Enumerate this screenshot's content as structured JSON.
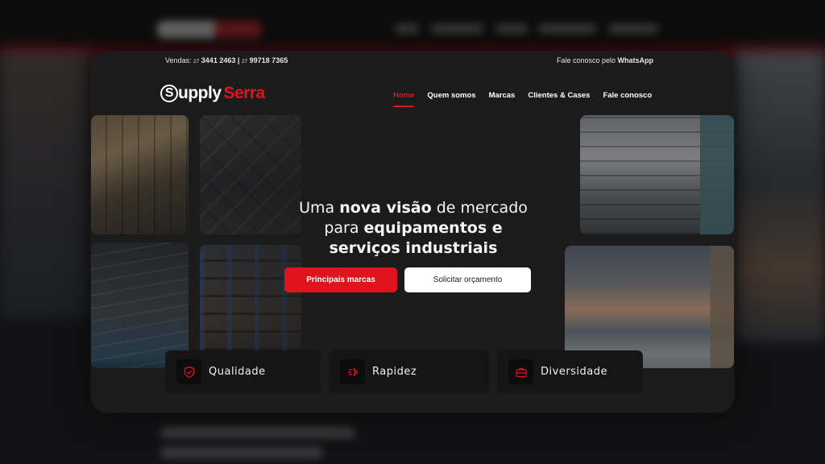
{
  "topbar": {
    "sales_label": "Vendas:",
    "phone1_prefix": "27",
    "phone1": "3441 2463",
    "separator": "|",
    "phone2_prefix": "27",
    "phone2": "99718 7365",
    "contact_text": "Fale conosco pelo",
    "contact_channel": "WhatsApp"
  },
  "logo": {
    "mark": "S",
    "word1": "upply",
    "word2": "Serra"
  },
  "nav": {
    "items": [
      {
        "label": "Home",
        "active": true
      },
      {
        "label": "Quem somos"
      },
      {
        "label": "Marcas"
      },
      {
        "label": "Clientes & Cases"
      },
      {
        "label": "Fale conosco"
      }
    ]
  },
  "hero": {
    "line1_a": "Uma ",
    "line1_b": "nova visão",
    "line1_c": " de mercado",
    "line2_a": "para ",
    "line2_b": "equipamentos e",
    "line3": "serviços industriais"
  },
  "buttons": {
    "primary": "Principais marcas",
    "secondary": "Solicitar orçamento"
  },
  "features": [
    {
      "label": "Qualidade",
      "icon": "shield-check-icon"
    },
    {
      "label": "Rapidez",
      "icon": "fast-arrow-icon"
    },
    {
      "label": "Diversidade",
      "icon": "toolbox-icon"
    }
  ],
  "colors": {
    "accent": "#e0141e",
    "card": "#1b1b1c",
    "feature_bg": "#151516"
  }
}
